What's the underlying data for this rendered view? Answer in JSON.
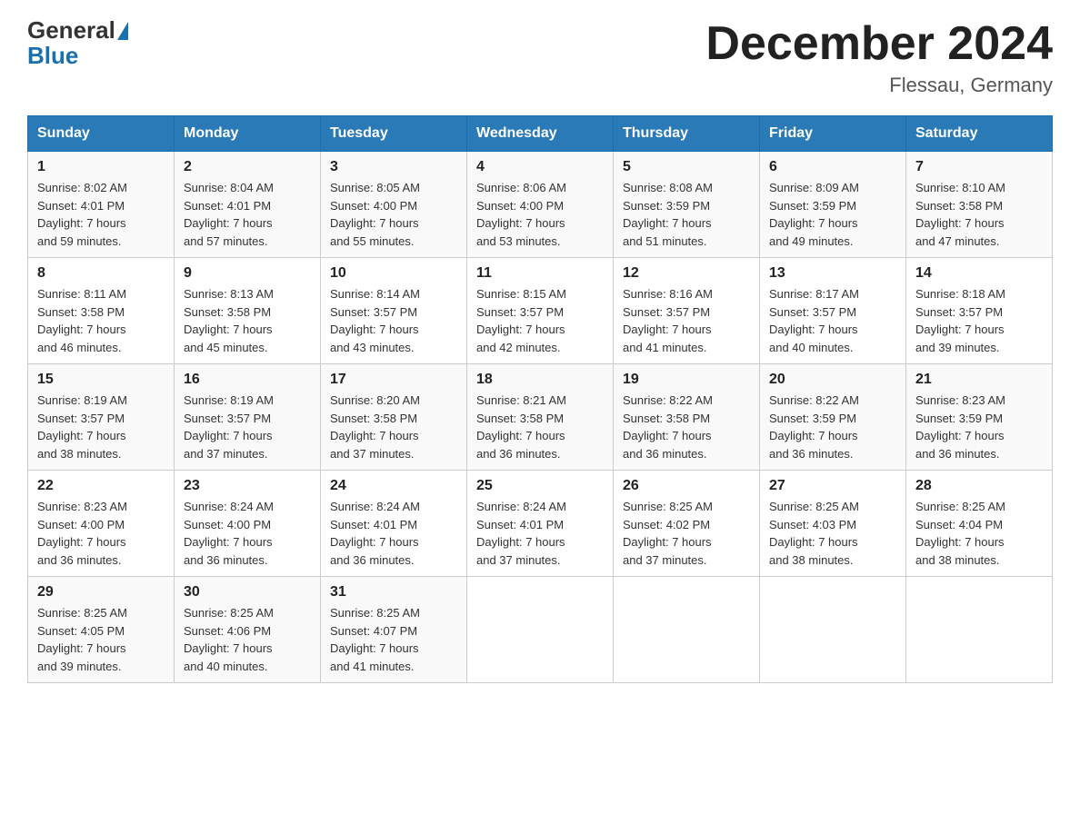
{
  "header": {
    "logo_general": "General",
    "logo_blue": "Blue",
    "month_title": "December 2024",
    "location": "Flessau, Germany"
  },
  "days_of_week": [
    "Sunday",
    "Monday",
    "Tuesday",
    "Wednesday",
    "Thursday",
    "Friday",
    "Saturday"
  ],
  "weeks": [
    [
      {
        "day": "1",
        "sunrise": "8:02 AM",
        "sunset": "4:01 PM",
        "daylight": "7 hours and 59 minutes."
      },
      {
        "day": "2",
        "sunrise": "8:04 AM",
        "sunset": "4:01 PM",
        "daylight": "7 hours and 57 minutes."
      },
      {
        "day": "3",
        "sunrise": "8:05 AM",
        "sunset": "4:00 PM",
        "daylight": "7 hours and 55 minutes."
      },
      {
        "day": "4",
        "sunrise": "8:06 AM",
        "sunset": "4:00 PM",
        "daylight": "7 hours and 53 minutes."
      },
      {
        "day": "5",
        "sunrise": "8:08 AM",
        "sunset": "3:59 PM",
        "daylight": "7 hours and 51 minutes."
      },
      {
        "day": "6",
        "sunrise": "8:09 AM",
        "sunset": "3:59 PM",
        "daylight": "7 hours and 49 minutes."
      },
      {
        "day": "7",
        "sunrise": "8:10 AM",
        "sunset": "3:58 PM",
        "daylight": "7 hours and 47 minutes."
      }
    ],
    [
      {
        "day": "8",
        "sunrise": "8:11 AM",
        "sunset": "3:58 PM",
        "daylight": "7 hours and 46 minutes."
      },
      {
        "day": "9",
        "sunrise": "8:13 AM",
        "sunset": "3:58 PM",
        "daylight": "7 hours and 45 minutes."
      },
      {
        "day": "10",
        "sunrise": "8:14 AM",
        "sunset": "3:57 PM",
        "daylight": "7 hours and 43 minutes."
      },
      {
        "day": "11",
        "sunrise": "8:15 AM",
        "sunset": "3:57 PM",
        "daylight": "7 hours and 42 minutes."
      },
      {
        "day": "12",
        "sunrise": "8:16 AM",
        "sunset": "3:57 PM",
        "daylight": "7 hours and 41 minutes."
      },
      {
        "day": "13",
        "sunrise": "8:17 AM",
        "sunset": "3:57 PM",
        "daylight": "7 hours and 40 minutes."
      },
      {
        "day": "14",
        "sunrise": "8:18 AM",
        "sunset": "3:57 PM",
        "daylight": "7 hours and 39 minutes."
      }
    ],
    [
      {
        "day": "15",
        "sunrise": "8:19 AM",
        "sunset": "3:57 PM",
        "daylight": "7 hours and 38 minutes."
      },
      {
        "day": "16",
        "sunrise": "8:19 AM",
        "sunset": "3:57 PM",
        "daylight": "7 hours and 37 minutes."
      },
      {
        "day": "17",
        "sunrise": "8:20 AM",
        "sunset": "3:58 PM",
        "daylight": "7 hours and 37 minutes."
      },
      {
        "day": "18",
        "sunrise": "8:21 AM",
        "sunset": "3:58 PM",
        "daylight": "7 hours and 36 minutes."
      },
      {
        "day": "19",
        "sunrise": "8:22 AM",
        "sunset": "3:58 PM",
        "daylight": "7 hours and 36 minutes."
      },
      {
        "day": "20",
        "sunrise": "8:22 AM",
        "sunset": "3:59 PM",
        "daylight": "7 hours and 36 minutes."
      },
      {
        "day": "21",
        "sunrise": "8:23 AM",
        "sunset": "3:59 PM",
        "daylight": "7 hours and 36 minutes."
      }
    ],
    [
      {
        "day": "22",
        "sunrise": "8:23 AM",
        "sunset": "4:00 PM",
        "daylight": "7 hours and 36 minutes."
      },
      {
        "day": "23",
        "sunrise": "8:24 AM",
        "sunset": "4:00 PM",
        "daylight": "7 hours and 36 minutes."
      },
      {
        "day": "24",
        "sunrise": "8:24 AM",
        "sunset": "4:01 PM",
        "daylight": "7 hours and 36 minutes."
      },
      {
        "day": "25",
        "sunrise": "8:24 AM",
        "sunset": "4:01 PM",
        "daylight": "7 hours and 37 minutes."
      },
      {
        "day": "26",
        "sunrise": "8:25 AM",
        "sunset": "4:02 PM",
        "daylight": "7 hours and 37 minutes."
      },
      {
        "day": "27",
        "sunrise": "8:25 AM",
        "sunset": "4:03 PM",
        "daylight": "7 hours and 38 minutes."
      },
      {
        "day": "28",
        "sunrise": "8:25 AM",
        "sunset": "4:04 PM",
        "daylight": "7 hours and 38 minutes."
      }
    ],
    [
      {
        "day": "29",
        "sunrise": "8:25 AM",
        "sunset": "4:05 PM",
        "daylight": "7 hours and 39 minutes."
      },
      {
        "day": "30",
        "sunrise": "8:25 AM",
        "sunset": "4:06 PM",
        "daylight": "7 hours and 40 minutes."
      },
      {
        "day": "31",
        "sunrise": "8:25 AM",
        "sunset": "4:07 PM",
        "daylight": "7 hours and 41 minutes."
      },
      null,
      null,
      null,
      null
    ]
  ],
  "labels": {
    "sunrise": "Sunrise:",
    "sunset": "Sunset:",
    "daylight": "Daylight:"
  }
}
